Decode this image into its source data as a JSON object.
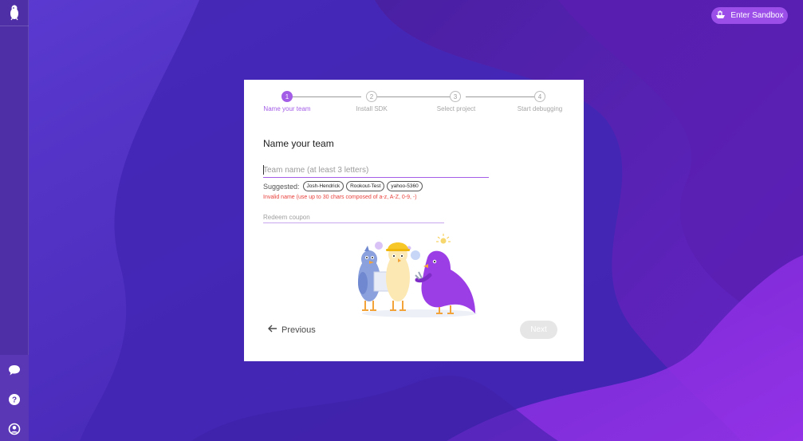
{
  "header": {
    "sandbox_label": "Enter Sandbox"
  },
  "sidebar": {
    "icons": [
      "logo-icon",
      "chat-icon",
      "help-icon",
      "account-icon"
    ]
  },
  "stepper": {
    "steps": [
      {
        "number": "1",
        "label": "Name your team",
        "active": true
      },
      {
        "number": "2",
        "label": "Install SDK",
        "active": false
      },
      {
        "number": "3",
        "label": "Select project",
        "active": false
      },
      {
        "number": "4",
        "label": "Start debugging",
        "active": false
      }
    ]
  },
  "form": {
    "title": "Name your team",
    "team_name_value": "",
    "team_name_placeholder": "Team name (at least 3 letters)",
    "suggested_label": "Suggested:",
    "suggestions": [
      "Josh-Hendrick",
      "Rookout-Test",
      "yahoo-5360"
    ],
    "error_text": "Invalid name (use up to 30 chars composed of a-z, A-Z, 0-9, -)",
    "coupon_value": "",
    "coupon_placeholder": "Redeem coupon"
  },
  "nav": {
    "previous_label": "Previous",
    "next_label": "Next"
  },
  "colors": {
    "accent": "#a35de6",
    "error": "#e8413c",
    "sandbox_button": "#9b4fe8"
  }
}
